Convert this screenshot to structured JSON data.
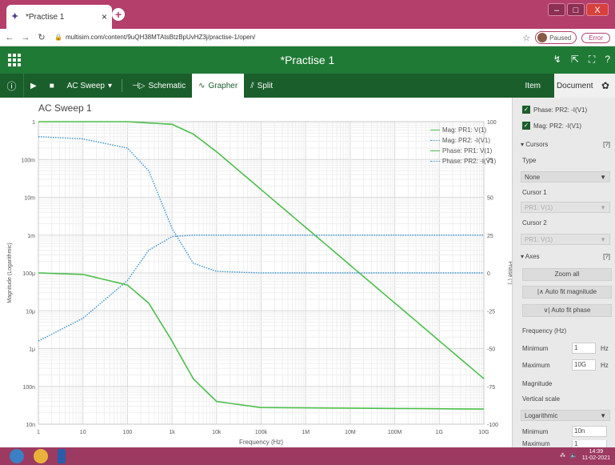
{
  "browser": {
    "tab_title": "*Practise 1",
    "tab_close": "×",
    "new_tab": "+",
    "url": "multisim.com/content/9uQH38MTAtsBtzBpUvHZ3j/practise-1/open/",
    "profile_status": "Paused",
    "error_label": "Error",
    "window_controls": {
      "minimize": "–",
      "maximize": "□",
      "close": "X"
    }
  },
  "app": {
    "title": "*Practise 1",
    "toolbar": {
      "info": "ⓘ",
      "run": "▶",
      "stop": "■",
      "analysis": "AC Sweep",
      "schematic": "Schematic",
      "grapher": "Grapher",
      "split": "Split"
    },
    "right_tabs": {
      "item": "Item",
      "document": "Document"
    }
  },
  "grapher": {
    "title": "AC Sweep 1",
    "legend": [
      {
        "label": "Mag: PR1: V(1)",
        "color": "#4cbf4c",
        "style": "solid"
      },
      {
        "label": "Mag: PR2: -I(V1)",
        "color": "#3a95cf",
        "style": "dotted"
      },
      {
        "label": "Phase: PR1: V(1)",
        "color": "#4cbf4c",
        "style": "solid"
      },
      {
        "label": "Phase: PR2: -I(V1)",
        "color": "#3a95cf",
        "style": "dotted"
      }
    ],
    "xlabel": "Frequency (Hz)",
    "ylabel_left": "Magnitude (Logarithmic)",
    "ylabel_right": "Phase (°)",
    "x_ticks": [
      "1",
      "10",
      "100",
      "1k",
      "10k",
      "100k",
      "1M",
      "10M",
      "100M",
      "1G",
      "10G"
    ],
    "y_left_ticks": [
      "1",
      "100m",
      "10m",
      "1m",
      "100μ",
      "10μ",
      "1μ",
      "100n",
      "10n"
    ],
    "y_right_ticks": [
      "100",
      "75",
      "50",
      "25",
      "0",
      "-25",
      "-50",
      "-75",
      "-100"
    ]
  },
  "chart_data": {
    "type": "line",
    "title": "AC Sweep 1",
    "xlabel": "Frequency (Hz)",
    "ylabel": "Magnitude (Logarithmic)",
    "y2label": "Phase (°)",
    "x_scale": "log",
    "y_scale": "log",
    "xlim": [
      1,
      10000000000
    ],
    "ylim": [
      1e-08,
      1
    ],
    "y2lim": [
      -100,
      100
    ],
    "grid": true,
    "legend_position": "top-right",
    "series": [
      {
        "name": "Mag: PR1: V(1)",
        "axis": "left",
        "color": "#4cbf4c",
        "style": "solid",
        "x": [
          1,
          100,
          1000,
          3000,
          10000,
          100000,
          1000000,
          10000000,
          100000000,
          1000000000,
          10000000000
        ],
        "y": [
          1,
          1,
          0.85,
          0.47,
          0.16,
          0.016,
          0.0016,
          0.00016,
          1.6e-05,
          1.6e-06,
          1.6e-07
        ]
      },
      {
        "name": "Mag: PR2: -I(V1)",
        "axis": "left",
        "color": "#3a95cf",
        "style": "dotted",
        "x": [
          1,
          10,
          100,
          300,
          1000,
          3000,
          10000,
          100000,
          1000000,
          10000000000
        ],
        "y": [
          0.4,
          0.35,
          0.2,
          0.05,
          0.0015,
          0.00018,
          0.00011,
          0.0001,
          0.0001,
          0.0001
        ]
      },
      {
        "name": "Phase: PR1: V(1)",
        "axis": "right",
        "color": "#4cbf4c",
        "style": "solid",
        "x": [
          1,
          10,
          100,
          300,
          1000,
          3000,
          10000,
          100000,
          10000000000
        ],
        "y": [
          0,
          -1,
          -8,
          -20,
          -45,
          -70,
          -85,
          -89,
          -90
        ]
      },
      {
        "name": "Phase: PR2: -I(V1)",
        "axis": "right",
        "color": "#3a95cf",
        "style": "dotted",
        "x": [
          1,
          10,
          100,
          300,
          1000,
          3000,
          10000,
          100000,
          10000000000
        ],
        "y": [
          -45,
          -30,
          -5,
          15,
          24,
          25,
          25,
          25,
          25
        ]
      }
    ]
  },
  "panel": {
    "checks": [
      "Phase: PR2: -I(V1)",
      "Mag: PR2: -I(V1)"
    ],
    "cursors_title": "Cursors",
    "help": "[?]",
    "type_label": "Type",
    "type_value": "None",
    "cursor1_label": "Cursor 1",
    "cursor1_value": "PR1: V(1)",
    "cursor2_label": "Cursor 2",
    "cursor2_value": "PR1: V(1)",
    "axes_title": "Axes",
    "zoom_all": "Zoom all",
    "autofit_magnitude": "|∧ Auto fit magnitude",
    "autofit_phase": "∨| Auto fit phase",
    "frequency_label": "Frequency (Hz)",
    "freq_min_label": "Minimum",
    "freq_min_value": "1",
    "freq_max_label": "Maximum",
    "freq_max_value": "10G",
    "hz": "Hz",
    "magnitude_label": "Magnitude",
    "vertical_scale_label": "Vertical scale",
    "vertical_scale_value": "Logarithmic",
    "mag_min_label": "Minimum",
    "mag_min_value": "10n",
    "mag_max_label": "Maximum",
    "mag_max_value": "1"
  },
  "taskbar": {
    "time": "14:39",
    "date": "11-02-2021"
  }
}
